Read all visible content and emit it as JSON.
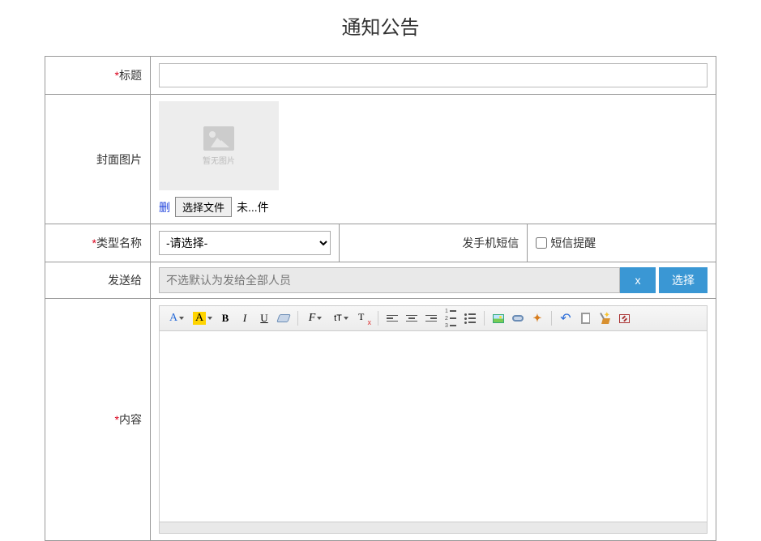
{
  "page": {
    "title": "通知公告"
  },
  "form": {
    "title": {
      "label": "标题",
      "value": ""
    },
    "cover": {
      "label": "封面图片",
      "placeholder_text": "暂无图片",
      "delete_label": "删",
      "choose_file_label": "选择文件",
      "file_status": "未...件"
    },
    "type_name": {
      "label": "类型名称",
      "selected": "-请选择-",
      "options": [
        "-请选择-"
      ]
    },
    "sms": {
      "label": "发手机短信",
      "checkbox_label": "短信提醒",
      "checked": false
    },
    "send_to": {
      "label": "发送给",
      "placeholder": "不选默认为发给全部人员",
      "clear_label": "x",
      "choose_label": "选择",
      "value": ""
    },
    "content": {
      "label": "内容"
    }
  },
  "editor_icons": {
    "forecolor": "A",
    "hilite": "A",
    "bold": "B",
    "italic": "I",
    "underline": "U",
    "fontfamily": "F",
    "fontsize": "tT",
    "flash": "✦",
    "undo": "↶"
  }
}
